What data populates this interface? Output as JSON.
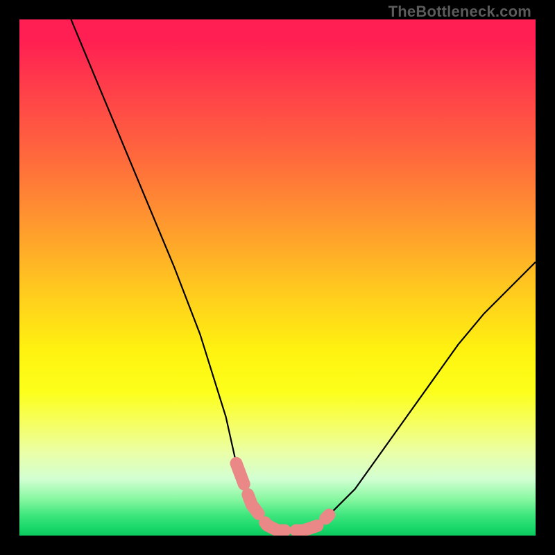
{
  "watermark": "TheBottleneck.com",
  "chart_data": {
    "type": "line",
    "title": "",
    "xlabel": "",
    "ylabel": "",
    "xlim": [
      0,
      100
    ],
    "ylim": [
      0,
      100
    ],
    "series": [
      {
        "name": "bottleneck-curve",
        "x": [
          10,
          15,
          20,
          25,
          30,
          35,
          40,
          42,
          45,
          48,
          50,
          55,
          58,
          60,
          65,
          70,
          75,
          80,
          85,
          90,
          95,
          100
        ],
        "values": [
          100,
          88,
          76,
          64,
          52,
          39,
          23,
          14,
          6,
          2,
          1,
          1,
          2,
          4,
          9,
          16,
          23,
          30,
          37,
          43,
          48,
          53
        ]
      }
    ],
    "highlight": {
      "name": "optimal-zone",
      "x": [
        42,
        45,
        48,
        50,
        55,
        58,
        60
      ],
      "values": [
        14,
        6,
        2,
        1,
        1,
        2,
        4
      ]
    },
    "background_gradient": {
      "top": "#ff1f52",
      "middle": "#fff210",
      "bottom": "#19d86a"
    }
  }
}
